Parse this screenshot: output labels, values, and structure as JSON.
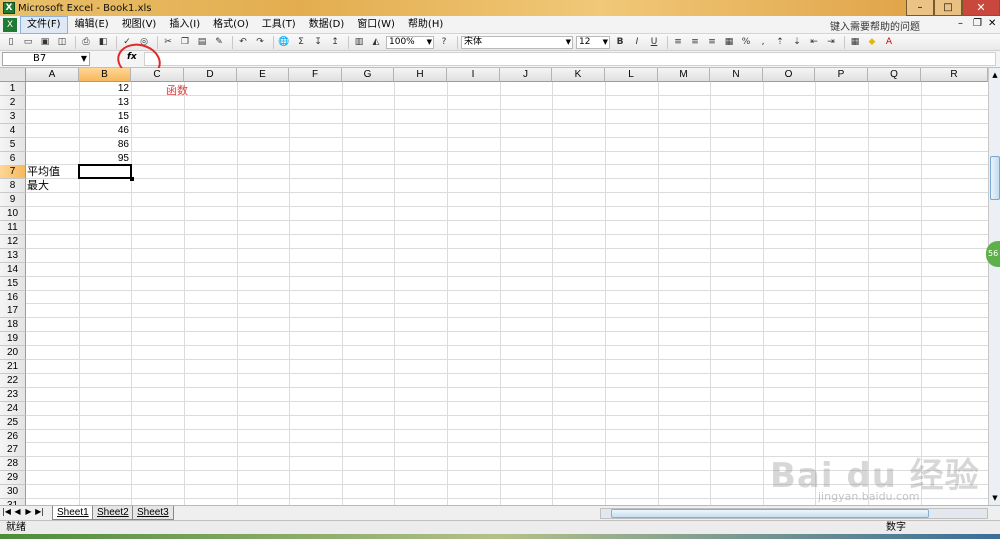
{
  "window": {
    "title": "Microsoft Excel - Book1.xls",
    "close_label": "✕"
  },
  "menu": {
    "items": [
      "文件(F)",
      "编辑(E)",
      "视图(V)",
      "插入(I)",
      "格式(O)",
      "工具(T)",
      "数据(D)",
      "窗口(W)",
      "帮助(H)"
    ],
    "help_prompt": "键入需要帮助的问题"
  },
  "toolbar": {
    "zoom": "100%",
    "font_name": "宋体",
    "font_size": "12",
    "percent_label": "%"
  },
  "formula_bar": {
    "name_box": "B7",
    "fx_label": "fx",
    "formula": ""
  },
  "annotation": {
    "text": "函数"
  },
  "grid": {
    "columns": [
      "A",
      "B",
      "C",
      "D",
      "E",
      "F",
      "G",
      "H",
      "I",
      "J",
      "K",
      "L",
      "M",
      "N",
      "O",
      "P",
      "Q",
      "R"
    ],
    "rows": [
      "1",
      "2",
      "3",
      "4",
      "5",
      "6",
      "7",
      "8",
      "9",
      "10",
      "11",
      "12",
      "13",
      "14",
      "15",
      "16",
      "17",
      "18",
      "19",
      "20",
      "21",
      "22",
      "23",
      "24",
      "25",
      "26",
      "27",
      "28",
      "29",
      "30",
      "31"
    ],
    "values_b": [
      "12",
      "13",
      "15",
      "46",
      "86",
      "95"
    ],
    "label_a7": "平均值",
    "label_a8": "最大",
    "selected_column": "B",
    "selected_row": "7"
  },
  "sheets": [
    "Sheet1",
    "Sheet2",
    "Sheet3"
  ],
  "status": {
    "left": "就绪",
    "right": "数字"
  },
  "badge": "56",
  "watermark": {
    "brand": "Bai du 经验",
    "url": "jingyan.baidu.com"
  }
}
